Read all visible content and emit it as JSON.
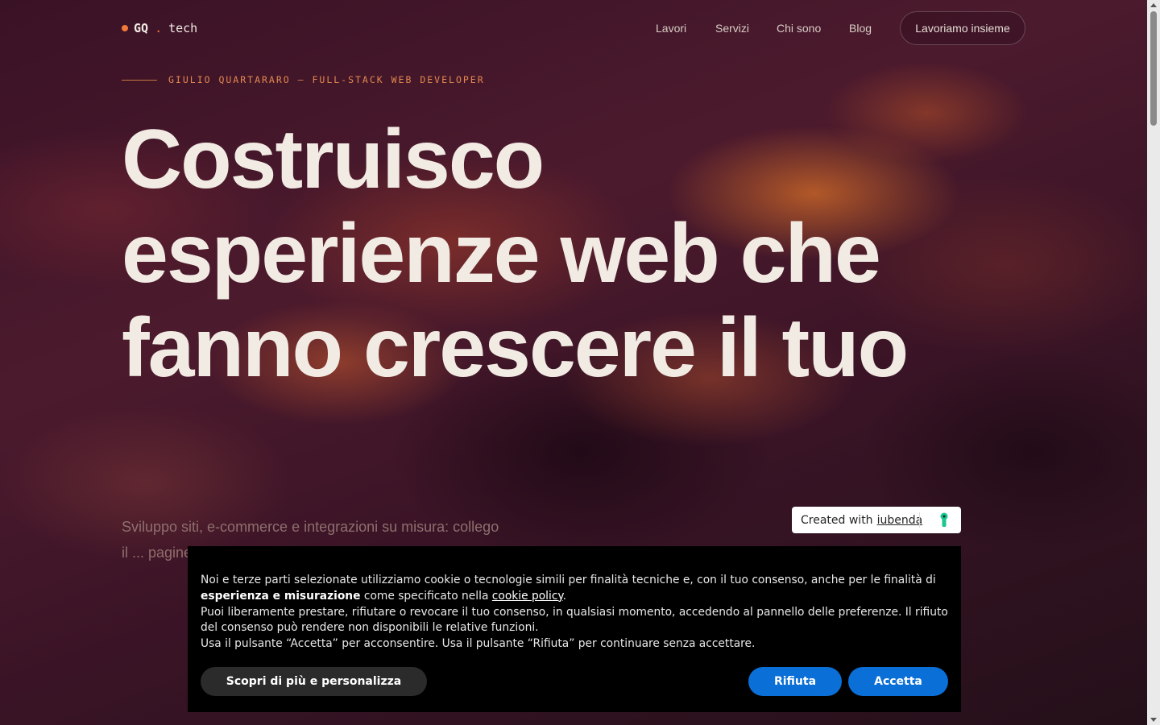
{
  "header": {
    "logo": {
      "prefix": "GQ",
      "separator": ".",
      "suffix": "tech"
    },
    "nav": [
      {
        "label": "Lavori"
      },
      {
        "label": "Servizi"
      },
      {
        "label": "Chi sono"
      },
      {
        "label": "Blog"
      }
    ],
    "cta_label": "Lavoriamo insieme"
  },
  "hero": {
    "eyebrow": "GIULIO QUARTARARO — FULL-STACK WEB DEVELOPER",
    "title_line1": "Costruisco",
    "title_line2": "esperienze web che",
    "title_line3": "fanno crescere il tuo",
    "subtitle": "Sviluppo siti, e-commerce e integrazioni su misura: collego il ... pagine be..."
  },
  "iubenda_badge": {
    "prefix": "Created with",
    "link": "iubenda",
    "icon": "keyhole-icon"
  },
  "cookie_banner": {
    "line1_start": "Noi e terze parti selezionate utilizziamo cookie o tecnologie simili per finalità tecniche e, con il tuo consenso, anche per le finalità di ",
    "line1_bold": "esperienza e misurazione",
    "line1_mid": " come specificato nella ",
    "line1_link": "cookie policy",
    "line1_end": ".",
    "line2": "Puoi liberamente prestare, rifiutare o revocare il tuo consenso, in qualsiasi momento, accedendo al pannello delle preferenze. Il rifiuto del consenso può rendere non disponibili le relative funzioni.",
    "line3": "Usa il pulsante “Accetta” per acconsentire. Usa il pulsante “Rifiuta” per continuare senza accettare.",
    "customize_label": "Scopri di più e personalizza",
    "reject_label": "Rifiuta",
    "accept_label": "Accetta"
  },
  "colors": {
    "accent": "#f07a3a",
    "button_blue": "#0a6fd6",
    "title_text": "#f1ebe3"
  }
}
